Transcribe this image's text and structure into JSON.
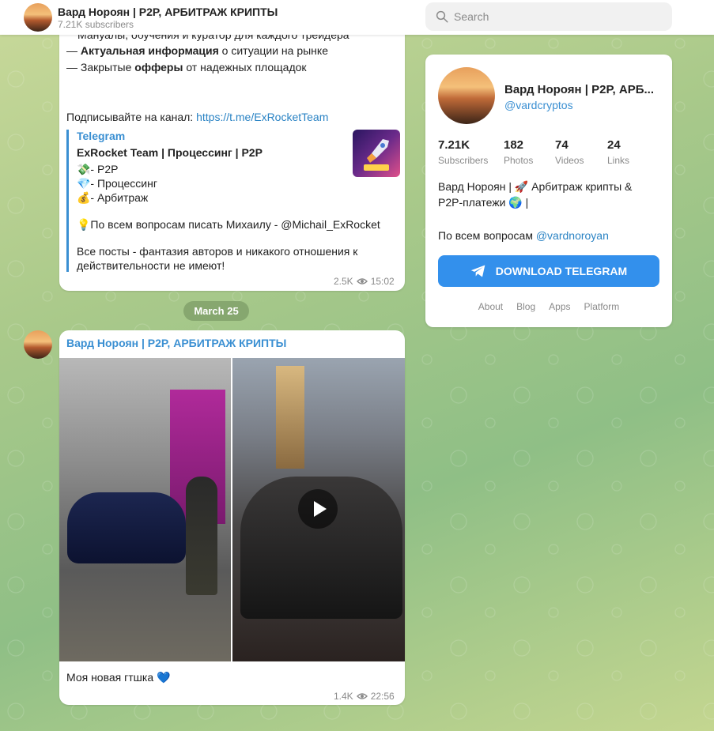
{
  "header": {
    "title": "Вард Нороян | P2P, АРБИТРАЖ КРИПТЫ",
    "subscribers": "7.21K subscribers",
    "search_placeholder": "Search"
  },
  "post1": {
    "line_top_partial": "Мануалы, обучения и куратор для каждого трейдера",
    "line2_dash": "— ",
    "line2_bold": "Актуальная информация",
    "line2_rest": " о ситуации на рынке",
    "line3_dash": "— Закрытые ",
    "line3_bold": "офферы",
    "line3_rest": " от надежных площадок",
    "subscribe_text": "Подписывайте на канал: ",
    "subscribe_link": "https://t.me/ExRocketTeam",
    "preview": {
      "site": "Telegram",
      "title": "ExRocket Team | Процессинг | P2P",
      "line1": "💸- P2P",
      "line2": "💎- Процессинг",
      "line3": "💰- Арбитраж",
      "line4": "💡По всем вопросам писать Михаилу - @Michail_ExRocket",
      "line5": "Все посты - фантазия авторов и никакого отношения к",
      "line6": "действительности не имеют!"
    },
    "views": "2.5K",
    "time": "15:02"
  },
  "date_separator": "March 25",
  "post2": {
    "author": "Вард Нороян | P2P, АРБИТРАЖ КРИПТЫ",
    "caption": "Моя новая гтшка 💙",
    "views": "1.4K",
    "time": "22:56"
  },
  "channel_card": {
    "title": "Вард Нороян | P2P, АРБ...",
    "handle": "@vardcryptos",
    "stats": [
      {
        "value": "7.21K",
        "label": "Subscribers"
      },
      {
        "value": "182",
        "label": "Photos"
      },
      {
        "value": "74",
        "label": "Videos"
      },
      {
        "value": "24",
        "label": "Links"
      }
    ],
    "desc_line1": "Вард Нороян | 🚀 Арбитраж крипты &",
    "desc_line2": "P2P-платежи 🌍 |",
    "desc_line3_prefix": "По всем вопросам ",
    "desc_line3_link": "@vardnoroyan",
    "download_label": "DOWNLOAD TELEGRAM",
    "footer_links": [
      "About",
      "Blog",
      "Apps",
      "Platform"
    ]
  },
  "colors": {
    "accent": "#3390ec",
    "link": "#2a83c4",
    "text": "#222222",
    "muted": "#8a8a8a"
  }
}
